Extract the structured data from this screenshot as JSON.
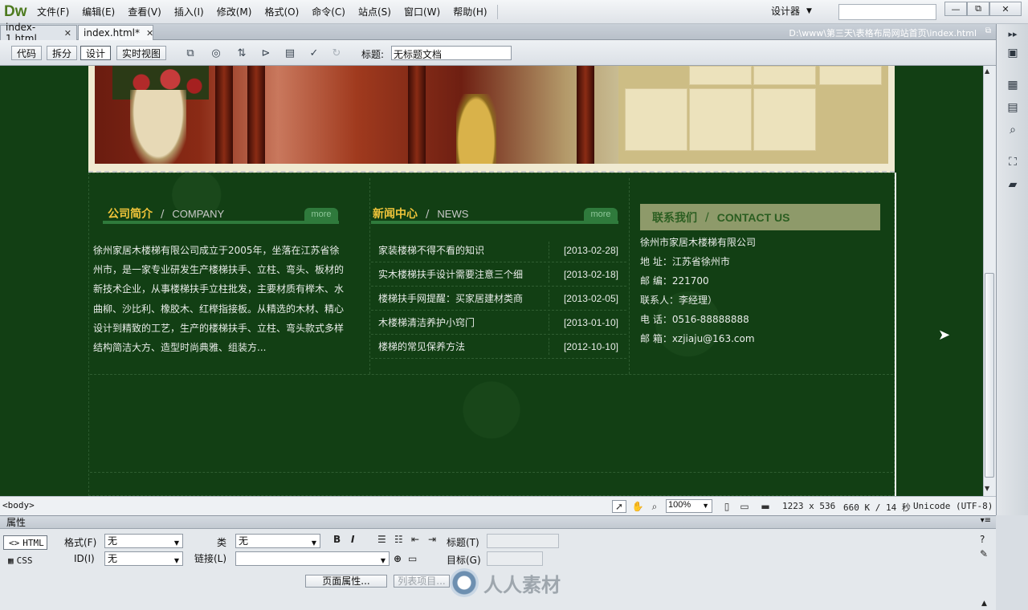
{
  "app": {
    "logo": "Dw",
    "menu": [
      "文件(F)",
      "编辑(E)",
      "查看(V)",
      "插入(I)",
      "修改(M)",
      "格式(O)",
      "命令(C)",
      "站点(S)",
      "窗口(W)",
      "帮助(H)"
    ],
    "workspace": "设计器",
    "window_buttons": [
      "—",
      "⧉",
      "✕"
    ]
  },
  "tabs": [
    {
      "label": "index-1.html",
      "active": false
    },
    {
      "label": "index.html*",
      "active": true
    }
  ],
  "file_path": "D:\\www\\第三天\\表格布局网站首页\\index.html",
  "doc_toolbar": {
    "views": [
      "代码",
      "拆分",
      "设计",
      "实时视图"
    ],
    "active_view": "设计",
    "title_label": "标题:",
    "title_value": "无标题文档"
  },
  "page": {
    "about": {
      "title_cn": "公司简介",
      "title_en": "COMPANY",
      "more": "more",
      "body": "徐州家居木楼梯有限公司成立于2005年，坐落在江苏省徐州市，是一家专业研发生产楼梯扶手、立柱、弯头、板材的新技术企业，从事楼梯扶手立柱批发，主要材质有榉木、水曲柳、沙比利、橡胶木、红榉指接板。从精选的木材、精心设计到精致的工艺，生产的楼梯扶手、立柱、弯头款式多样结构简洁大方、造型时尚典雅、组装方..."
    },
    "news": {
      "title_cn": "新闻中心",
      "title_en": "NEWS",
      "more": "more",
      "items": [
        {
          "title": "家装楼梯不得不看的知识",
          "date": "[2013-02-28]"
        },
        {
          "title": "实木楼梯扶手设计需要注意三个细",
          "date": "[2013-02-18]"
        },
        {
          "title": "楼梯扶手网提醒：买家居建材类商",
          "date": "[2013-02-05]"
        },
        {
          "title": "木楼梯清洁养护小窍门",
          "date": "[2013-01-10]"
        },
        {
          "title": "楼梯的常见保养方法",
          "date": "[2012-10-10]"
        }
      ]
    },
    "contact": {
      "title_cn": "联系我们",
      "title_en": "CONTACT US",
      "lines": [
        "徐州市家居木楼梯有限公司",
        "地  址：江苏省徐州市",
        "邮  编：221700",
        "联系人：李经理）",
        "电  话：0516-88888888",
        "邮  箱：xzjiaju@163.com"
      ]
    }
  },
  "statusbar": {
    "tag": "<body>",
    "zoom": "100%",
    "size": "1223 x 536",
    "filesize": "660 K / 14 秒",
    "encoding": "Unicode (UTF-8)"
  },
  "properties": {
    "title": "属性",
    "modes": [
      "HTML",
      "CSS"
    ],
    "format_label": "格式(F)",
    "format_value": "无",
    "id_label": "ID(I)",
    "id_value": "无",
    "class_label": "类",
    "class_value": "无",
    "link_label": "链接(L)",
    "link_value": "",
    "title_label": "标题(T)",
    "target_label": "目标(G)",
    "bold": "B",
    "italic": "I",
    "page_props_button": "页面属性...",
    "list_items_button": "列表项目..."
  },
  "watermark": "人人素材"
}
